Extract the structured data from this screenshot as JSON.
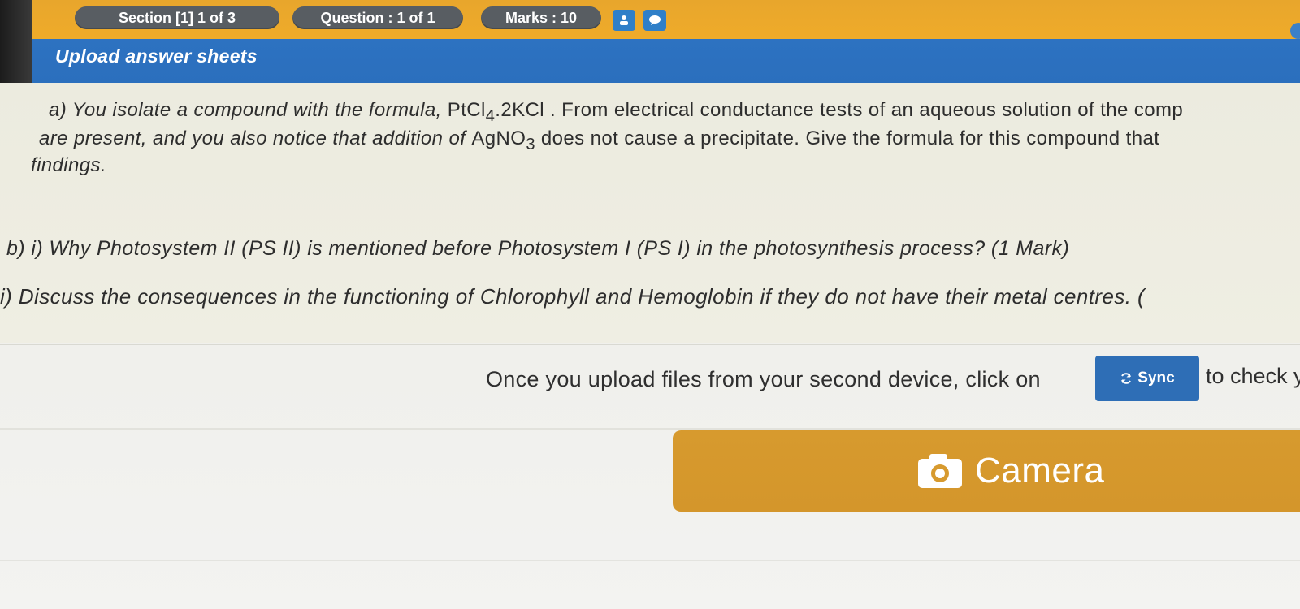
{
  "topbar": {
    "section": "Section [1] 1 of 3",
    "question": "Question : 1 of 1",
    "marks": "Marks : 10",
    "icons": [
      "user-icon",
      "chat-icon"
    ]
  },
  "header": {
    "title": "Upload answer sheets"
  },
  "question": {
    "a_line1_pre": "a) You isolate a compound with the formula, ",
    "a_formula": "PtCl",
    "a_formula_sub": "4",
    "a_formula_rest": ".2KCl",
    "a_line1_post": " . From electrical conductance tests of an aqueous solution of the comp",
    "a_line2_pre": "are present, and you also notice that addition of ",
    "a_reagent": "AgNO",
    "a_reagent_sub": "3",
    "a_line2_post": " does not cause a precipitate. Give the formula for this compound that",
    "a_line3": "findings.",
    "b_i": "b) i) Why Photosystem II (PS II) is mentioned before Photosystem I (PS I) in the photosynthesis process? (1 Mark)",
    "b_ii": "i) Discuss the consequences in the functioning of Chlorophyll and Hemoglobin if they do not have their metal centres. ("
  },
  "sync": {
    "prefix": "Once you upload files from your second device, click on",
    "button_label": "Sync",
    "suffix": "to check y"
  },
  "camera": {
    "label": "Camera"
  },
  "colors": {
    "topbar": "#efab2a",
    "header": "#2d72c1",
    "camera": "#d79a2e",
    "sync_button": "#2e6eb6"
  }
}
